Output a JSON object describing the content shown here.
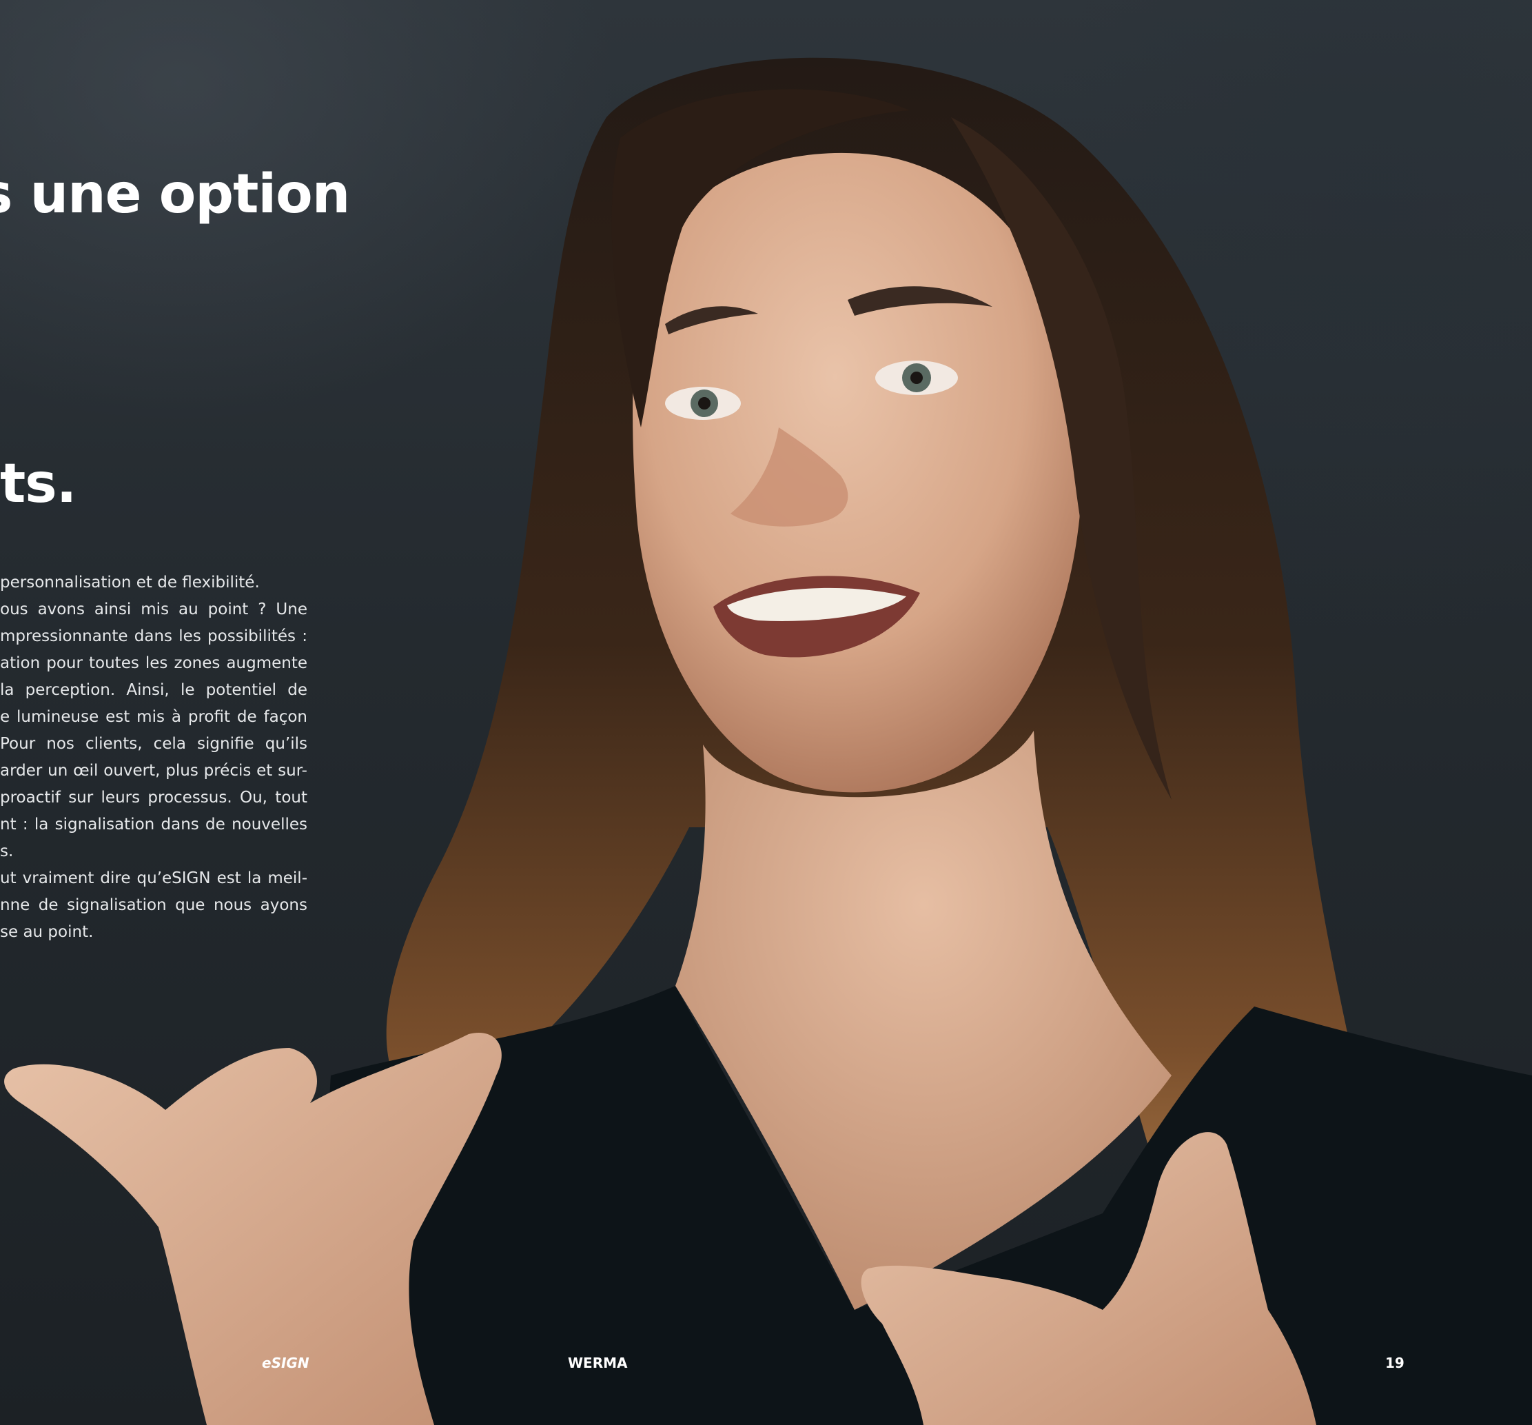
{
  "heading": {
    "line1": "s une option",
    "line2": "ts."
  },
  "body": {
    "lines": [
      "personnalisation et de flexibilité.",
      "ous avons ainsi mis au point ? Une",
      "mpressionnante dans les possibilités :",
      "ation pour toutes les zones augmente",
      "la perception. Ainsi, le potentiel de",
      "e lumineuse est mis à profit de façon",
      "Pour nos clients, cela signifie qu’ils",
      "arder un œil ouvert, plus précis et sur-",
      "proactif sur leurs processus. Ou, tout",
      "nt : la signalisation dans de nouvelles",
      "s.",
      "ut vraiment dire qu’eSIGN est la meil-",
      "nne de signalisation que nous ayons",
      "se au point."
    ]
  },
  "footer": {
    "left": "eSIGN",
    "center": "WERMA",
    "right": "19"
  }
}
